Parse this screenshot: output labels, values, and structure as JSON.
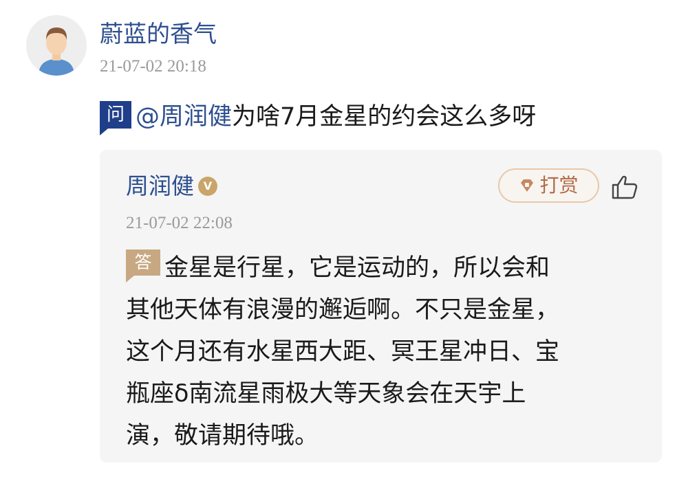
{
  "post": {
    "author": "蔚蓝的香气",
    "time": "21-07-02 20:18",
    "avatar_icon": "person-avatar-icon"
  },
  "question": {
    "badge": "问",
    "mention": "@周润健",
    "text": "为啥7月金星的约会这么多呀"
  },
  "answer": {
    "author": "周润健",
    "verified_badge": "V",
    "time": "21-07-02 22:08",
    "tip_label": "打赏",
    "tip_icon": "diamond-coin-icon",
    "like_icon": "thumbs-up-icon",
    "badge": "答",
    "lines": [
      "金星是行星，它是运动的，所以会和",
      "其他天体有浪漫的邂逅啊。不只是金星，",
      "这个月还有水星西大距、冥王星冲日、宝",
      "瓶座δ南流星雨极大等天象会在天宇上",
      "演，敬请期待哦。"
    ]
  },
  "colors": {
    "link_blue": "#2e4f8f",
    "question_badge": "#1f3f8a",
    "answer_badge": "#c7a882",
    "card_bg": "#f5f5f5",
    "tip_text": "#b06a45"
  }
}
